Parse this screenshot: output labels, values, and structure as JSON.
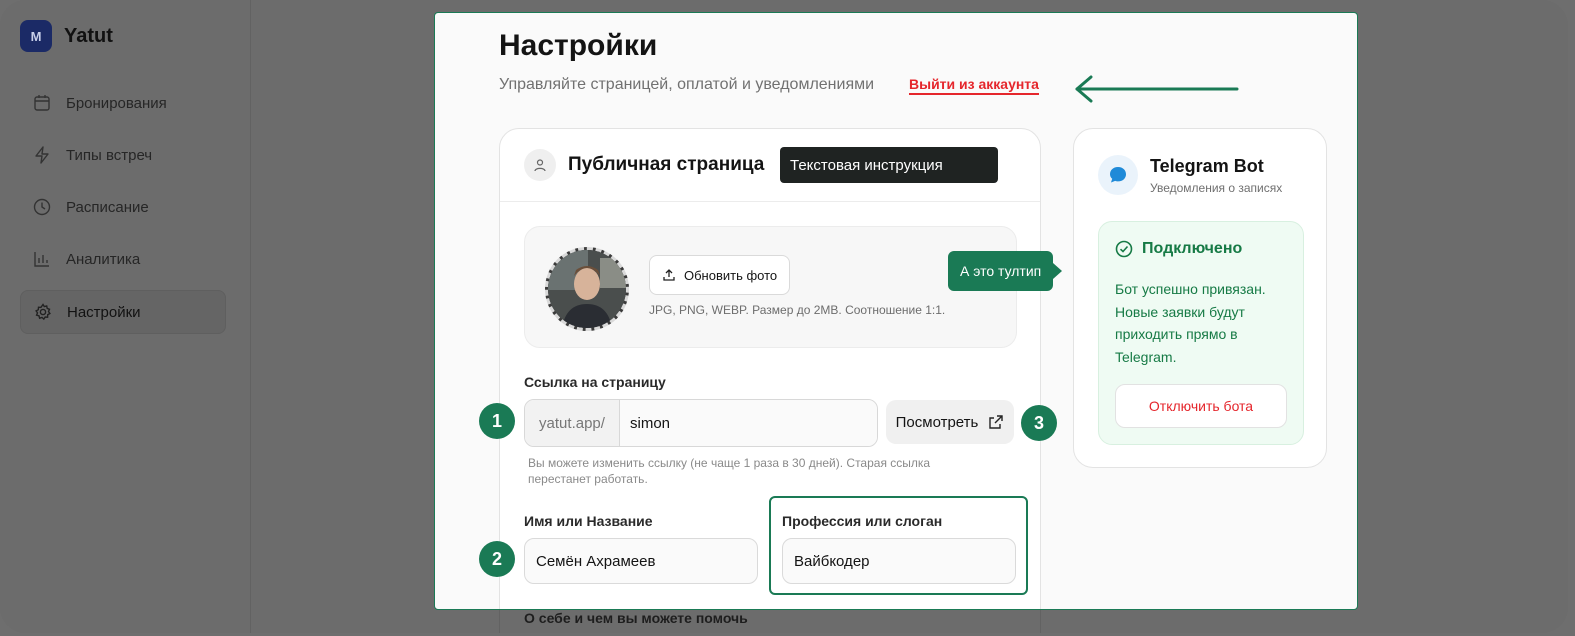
{
  "app": {
    "logo_letter": "M",
    "name": "Yatut"
  },
  "sidebar": {
    "items": [
      {
        "label": "Бронирования",
        "icon": "calendar-icon",
        "active": false
      },
      {
        "label": "Типы встреч",
        "icon": "lightning-icon",
        "active": false
      },
      {
        "label": "Расписание",
        "icon": "clock-icon",
        "active": false
      },
      {
        "label": "Аналитика",
        "icon": "bar-chart-icon",
        "active": false
      },
      {
        "label": "Настройки",
        "icon": "gear-icon",
        "active": true
      }
    ]
  },
  "settings": {
    "title": "Настройки",
    "subtitle": "Управляйте страницей, оплатой и уведомлениями",
    "logout_label": "Выйти из аккаунта"
  },
  "public_page": {
    "title": "Публичная страница",
    "annotation": "Текстовая инструкция",
    "upload_label": "Обновить фото",
    "photo_hint": "JPG, PNG, WEBP. Размер до 2MB. Соотношение 1:1.",
    "link_label": "Ссылка на страницу",
    "url_prefix": "yatut.app/",
    "url_value": "simon",
    "view_label": "Посмотреть",
    "link_hint": "Вы можете изменить ссылку (не чаще 1 раза в 30 дней). Старая ссылка перестанет работать.",
    "name_label": "Имя или Название",
    "name_value": "Семён Ахрамеев",
    "slogan_label": "Профессия или слоган",
    "slogan_value": "Вайбкодер",
    "about_label": "О себе и чем вы можете помочь"
  },
  "tooltip": {
    "text": "А это тултип"
  },
  "steps": [
    "1",
    "2",
    "3"
  ],
  "telegram": {
    "title": "Telegram Bot",
    "subtitle": "Уведомления о записях",
    "status": "Подключено",
    "description": "Бот успешно привязан. Новые заявки будут приходить прямо в Telegram.",
    "disconnect_label": "Отключить бота"
  },
  "colors": {
    "accent": "#1a7a55",
    "danger": "#e5262c",
    "overlay": "#6c6c6c",
    "success_text": "#167a45"
  }
}
